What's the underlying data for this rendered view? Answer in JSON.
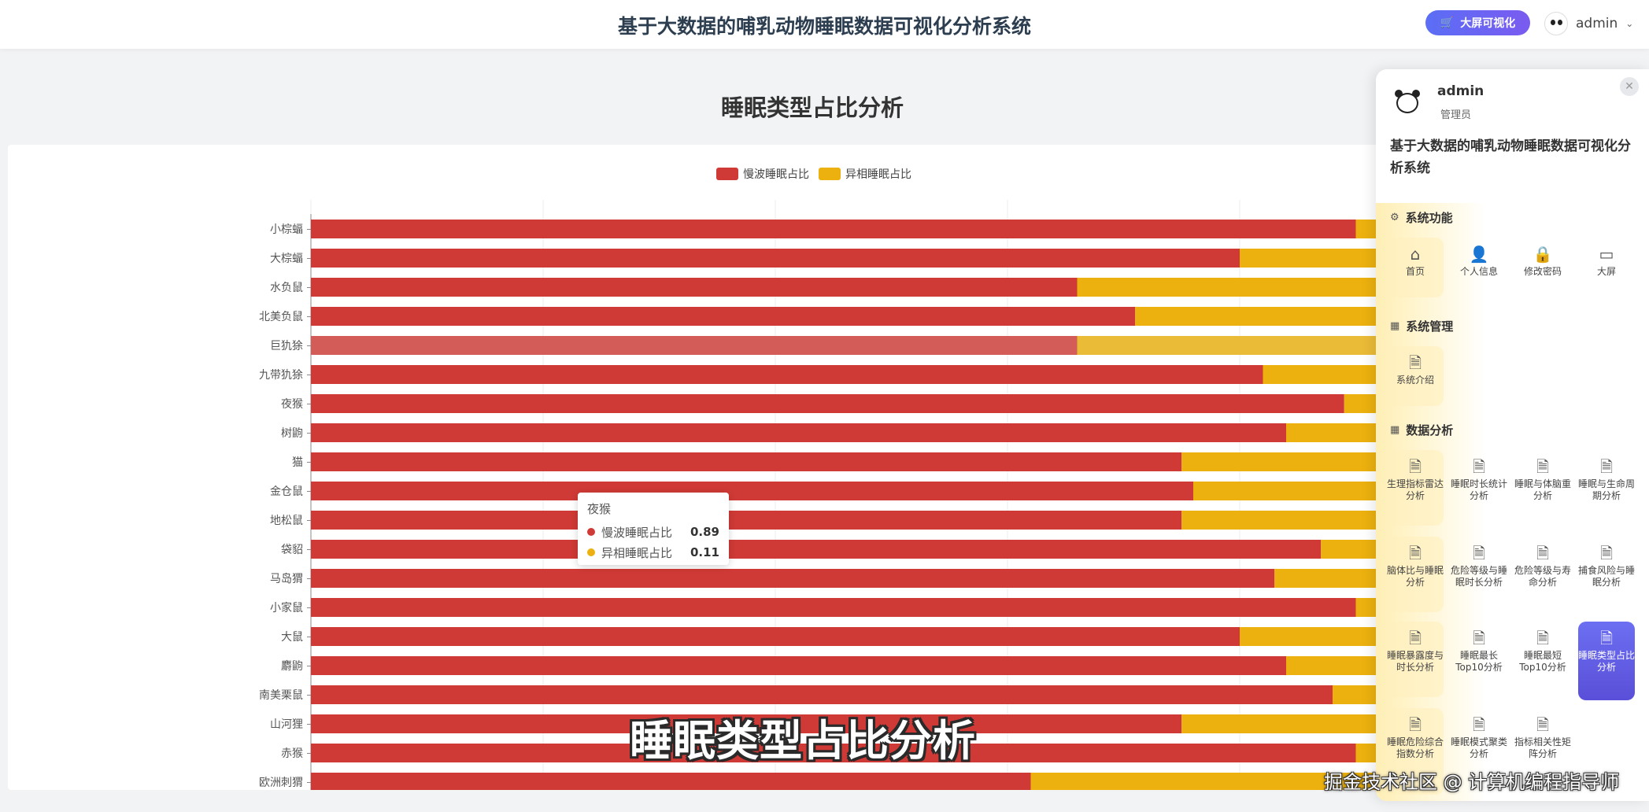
{
  "header": {
    "title": "基于大数据的哺乳动物睡眠数据可视化分析系统",
    "bigscreen_label": "大屏可视化",
    "user_name": "admin"
  },
  "page": {
    "heading": "睡眠类型占比分析"
  },
  "chart_data": {
    "type": "bar",
    "orientation": "horizontal",
    "stacked": true,
    "xlim": [
      0,
      1
    ],
    "grid": true,
    "legend_position": "top-center",
    "categories": [
      "小棕蝠",
      "大棕蝠",
      "水负鼠",
      "北美负鼠",
      "巨犰狳",
      "九带犰狳",
      "夜猴",
      "树鼩",
      "猫",
      "金仓鼠",
      "地松鼠",
      "袋貂",
      "马岛猬",
      "小家鼠",
      "大鼠",
      "麝鼩",
      "南美栗鼠",
      "山河狸",
      "赤猴",
      "欧洲刺猬"
    ],
    "series": [
      {
        "name": "慢波睡眠占比",
        "color": "#d03a36",
        "values": [
          0.9,
          0.8,
          0.66,
          0.71,
          0.66,
          0.82,
          0.89,
          0.84,
          0.75,
          0.76,
          0.75,
          0.87,
          0.83,
          0.9,
          0.8,
          0.84,
          0.88,
          0.75,
          0.9,
          0.62
        ]
      },
      {
        "name": "异相睡眠占比",
        "color": "#ecb10f",
        "values": [
          0.1,
          0.2,
          0.34,
          0.29,
          0.34,
          0.18,
          0.11,
          0.16,
          0.25,
          0.24,
          0.25,
          0.13,
          0.17,
          0.1,
          0.2,
          0.16,
          0.12,
          0.25,
          0.1,
          0.38
        ]
      }
    ],
    "highlighted_category": "巨犰狳",
    "tooltip": {
      "title": "夜猴",
      "rows": [
        {
          "label": "慢波睡眠占比",
          "value": "0.89",
          "color": "#d03a36"
        },
        {
          "label": "异相睡眠占比",
          "value": "0.11",
          "color": "#ecb10f"
        }
      ]
    }
  },
  "side_panel": {
    "user": "admin",
    "role": "管理员",
    "system_name": "基于大数据的哺乳动物睡眠数据可视化分析系统",
    "sections": [
      {
        "title": "系统功能",
        "icon": "gear-icon",
        "items": [
          {
            "label": "首页",
            "icon": "home-icon"
          },
          {
            "label": "个人信息",
            "icon": "user-icon"
          },
          {
            "label": "修改密码",
            "icon": "lock-icon"
          },
          {
            "label": "大屏",
            "icon": "screen-icon"
          }
        ]
      },
      {
        "title": "系统管理",
        "icon": "grid-icon",
        "items": [
          {
            "label": "系统介绍",
            "icon": "document-icon"
          }
        ]
      },
      {
        "title": "数据分析",
        "icon": "grid-icon",
        "items": [
          {
            "label": "生理指标雷达分析",
            "icon": "document-icon"
          },
          {
            "label": "睡眠时长统计分析",
            "icon": "document-icon"
          },
          {
            "label": "睡眠与体脑重分析",
            "icon": "document-icon"
          },
          {
            "label": "睡眠与生命周期分析",
            "icon": "document-icon"
          },
          {
            "label": "脑体比与睡眠分析",
            "icon": "document-icon"
          },
          {
            "label": "危险等级与睡眠时长分析",
            "icon": "document-icon"
          },
          {
            "label": "危险等级与寿命分析",
            "icon": "document-icon"
          },
          {
            "label": "捕食风险与睡眠分析",
            "icon": "document-icon"
          },
          {
            "label": "睡眠暴露度与时长分析",
            "icon": "document-icon"
          },
          {
            "label": "睡眠最长Top10分析",
            "icon": "document-icon"
          },
          {
            "label": "睡眠最短Top10分析",
            "icon": "document-icon"
          },
          {
            "label": "睡眠类型占比分析",
            "icon": "document-icon",
            "active": true
          },
          {
            "label": "睡眠危险综合指数分析",
            "icon": "document-icon"
          },
          {
            "label": "睡眠模式聚类分析",
            "icon": "document-icon"
          },
          {
            "label": "指标相关性矩阵分析",
            "icon": "document-icon"
          }
        ]
      }
    ]
  },
  "overlay": {
    "caption": "睡眠类型占比分析",
    "watermark": "掘金技术社区 @ 计算机编程指导师"
  }
}
